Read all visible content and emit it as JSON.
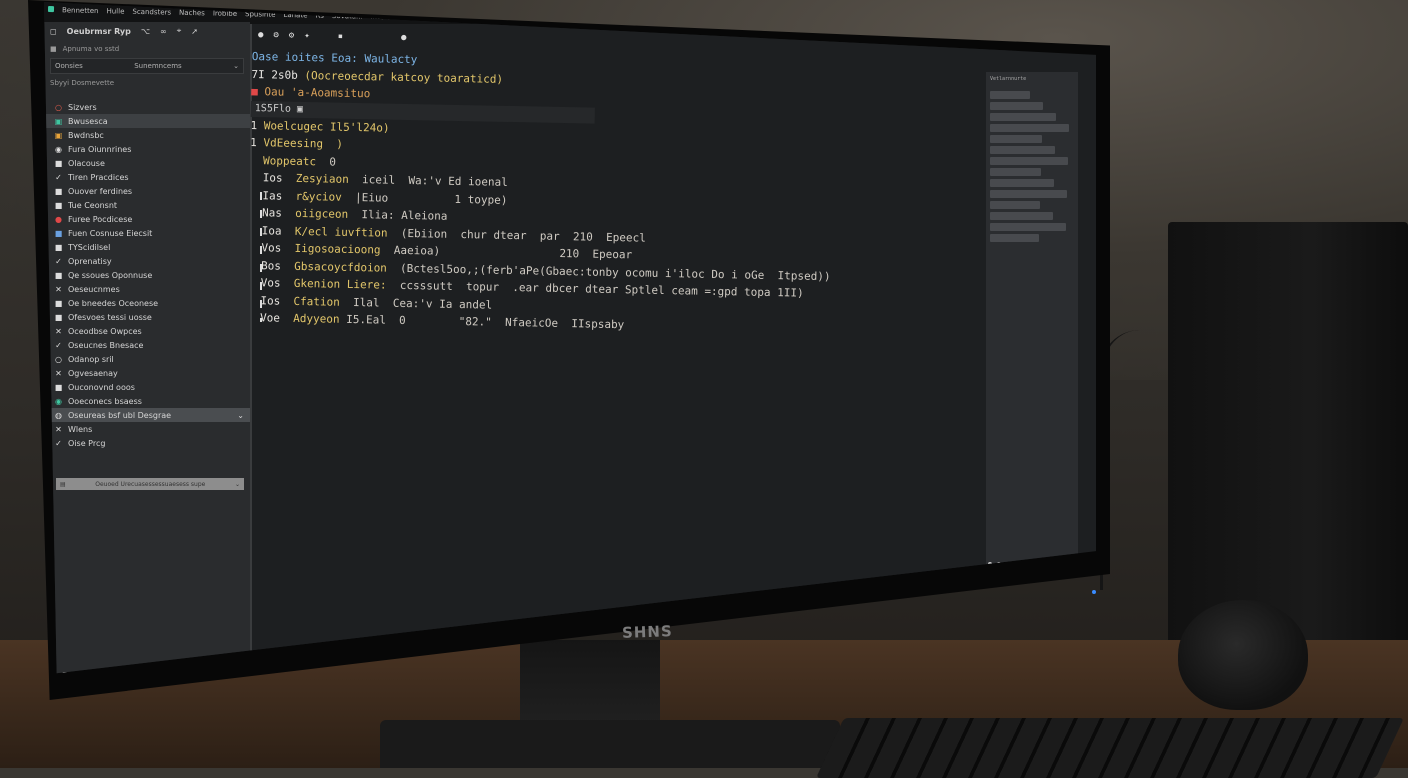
{
  "monitor": {
    "brand": "SHNS"
  },
  "menubar": {
    "items": [
      "Bennetten",
      "Hulle",
      "Scandsters",
      "Naches",
      "Irobibe",
      "Spusinte",
      "Lahate",
      "Rs",
      "Sovatanl",
      "Interontie"
    ]
  },
  "sidebar": {
    "toolbar_title": "Oeubrmsr Ryp",
    "field_label": "Apnuma vo sstd",
    "select_label": "Oonsies",
    "select_value": "Sunemncems",
    "subfield": "Sbyyi   Dosmevette",
    "tree": [
      {
        "icon": "○",
        "label": "Sizvers",
        "color": "#e05b4b"
      },
      {
        "icon": "▣",
        "label": "Bwusesca",
        "color": "#3ec6a0",
        "selected": true
      },
      {
        "icon": "▣",
        "label": "Bwdnsbc",
        "color": "#e8a43a"
      },
      {
        "icon": "◉",
        "label": "Fura Oiunnrines",
        "color": "#ddd"
      },
      {
        "icon": "■",
        "label": "Olacouse",
        "color": "#ddd"
      },
      {
        "icon": "✓",
        "label": "Tiren Pracdices",
        "color": "#ddd"
      },
      {
        "icon": "■",
        "label": "Ouover ferdines",
        "color": "#ddd"
      },
      {
        "icon": "■",
        "label": "Tue Ceonsnt",
        "color": "#ddd"
      },
      {
        "icon": "●",
        "label": "Furee Pocdicese",
        "color": "#e04848"
      },
      {
        "icon": "■",
        "label": "Fuen Cosnuse Eiecsit",
        "color": "#6aa0e0"
      },
      {
        "icon": "■",
        "label": "TYScidilsel",
        "color": "#ddd"
      },
      {
        "icon": "✓",
        "label": "Oprenatisy",
        "color": "#ddd"
      },
      {
        "icon": "■",
        "label": "Qe ssoues Oponnuse",
        "color": "#ddd"
      },
      {
        "icon": "✕",
        "label": "Oeseucnmes",
        "color": "#ddd"
      },
      {
        "icon": "■",
        "label": "Oe bneedes Oceonese",
        "color": "#ddd"
      },
      {
        "icon": "■",
        "label": "Ofesvoes tessi uosse",
        "color": "#ddd"
      },
      {
        "icon": "✕",
        "label": "Oceodbse Owpces",
        "color": "#ddd"
      },
      {
        "icon": "✓",
        "label": "Oseucnes Bnesace",
        "color": "#ddd"
      },
      {
        "icon": "○",
        "label": "Odanop sril",
        "color": "#ddd"
      },
      {
        "icon": "✕",
        "label": "Ogvesaenay",
        "color": "#ddd"
      },
      {
        "icon": "■",
        "label": "Ouconovnd ooos",
        "color": "#ddd"
      },
      {
        "icon": "◉",
        "label": "Ooeconecs bsaess",
        "color": "#3ec6a0"
      },
      {
        "icon": "◍",
        "label": "Oseureas bsf ubl Desgrae",
        "color": "#ddd",
        "highlight": true
      },
      {
        "icon": "✕",
        "label": "Wlens",
        "color": "#ddd"
      },
      {
        "icon": "✓",
        "label": "Oise Prcg",
        "color": "#ddd"
      }
    ],
    "status": "Oeuoed Urecuasessessuaesess supe"
  },
  "editor": {
    "header_link": "Oase ioites Eoa: Waulacty",
    "header_line2_num": "7I 2s0b",
    "header_line2_text": "(Oocreoecdar katcoy toaraticd)",
    "header_line3": "Oau 'a-Aoamsituo",
    "find_text": "1S5Flo",
    "lines": [
      {
        "a": "1 ",
        "b": "Woelcugec Il5'l24o)",
        "c": ""
      },
      {
        "a": "1 ",
        "b": "VdEeesing  )",
        "c": ""
      },
      {
        "a": "  ",
        "b": "Woppeatc  ",
        "c": "0"
      },
      {
        "a": "  Ios  ",
        "b": "Zesyiaon  ",
        "c": "iceil  Wa:'v Ed ioenal"
      },
      {
        "a": "  Ias  ",
        "b": "r&yciov  ",
        "c": "|Eiuo          1 toype)"
      },
      {
        "a": "  Nas  ",
        "b": "oiigceon  ",
        "c": "Ilia: Aleiona"
      },
      {
        "a": "  Ioa  ",
        "b": "K/ecl iuvftion  ",
        "c": "(Ebiion  chur dtear  par  210  Epeecl"
      },
      {
        "a": "  Vos  ",
        "b": "Iigosoacioong  ",
        "c": "Aaeioa)                  210  Epeoar"
      },
      {
        "a": "  Bos  ",
        "b": "Gbsacoycfdoion  ",
        "c": "(Bctesl5oo,;(ferb'aPe(Gbaec:tonby ocomu i'iloc Do i oGe  Itpsed))"
      },
      {
        "a": "  Vos  ",
        "b": "Gkenion Liere:  ",
        "c": "ccsssutt  topur  .ear dbcer dtear Sptlel ceam =:gpd topa 1II)"
      },
      {
        "a": "  Ios  ",
        "b": "Cfation  ",
        "c": "Ilal  Cea:'v Ia andel"
      },
      {
        "a": "  Voe  ",
        "b": "Adyyeon ",
        "c": "I5.Eal  0        \"82.\"  NfaeicOe  IIspsaby"
      }
    ]
  },
  "right_panel": {
    "title": "Vetlarnnurte"
  },
  "colors": {
    "accent_green": "#3ec6a0",
    "code_yellow": "#e2c66a",
    "link_blue": "#7db5e6",
    "screen_bg": "#1d1f21"
  }
}
